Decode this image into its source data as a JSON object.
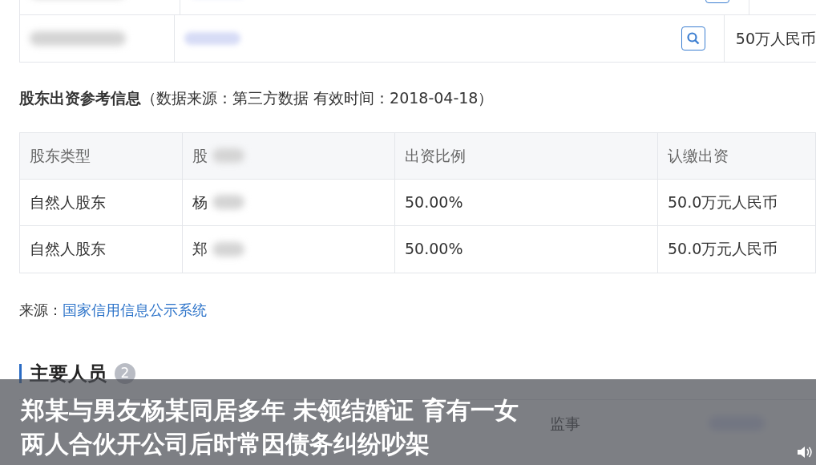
{
  "top_table": {
    "amount": "50万人民币"
  },
  "shareholders": {
    "title": "股东出资参考信息",
    "note": "（数据来源：第三方数据 有效时间：2018-04-18）",
    "columns": [
      "股东类型",
      "股",
      "出资比例",
      "认缴出资"
    ],
    "rows": [
      {
        "type": "自然人股东",
        "name": "杨",
        "ratio": "50.00%",
        "amount": "50.0万元人民币"
      },
      {
        "type": "自然人股东",
        "name": "郑",
        "ratio": "50.00%",
        "amount": "50.0万元人民币"
      }
    ],
    "source_label": "来源：",
    "source_link": "国家信用信息公示系统"
  },
  "personnel": {
    "title": "主要人员",
    "count": "2",
    "role": "监事"
  },
  "subtitles": [
    "郑某与男友杨某同居多年 未领结婚证 育有一女",
    "两人合伙开公司后时常因债务纠纷吵架"
  ]
}
